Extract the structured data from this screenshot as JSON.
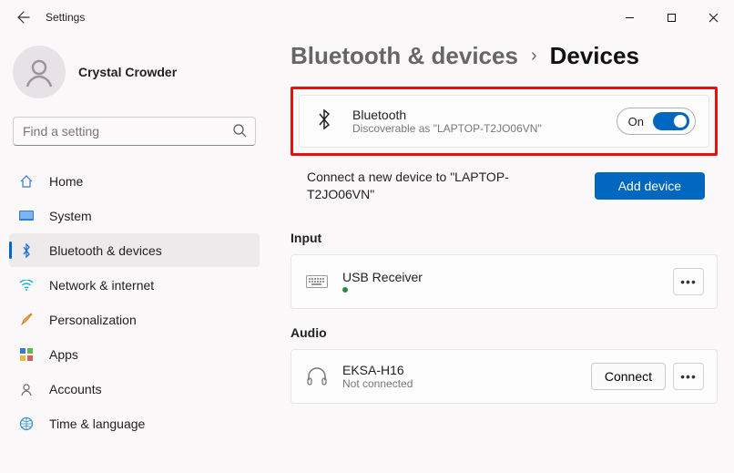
{
  "window": {
    "title": "Settings"
  },
  "user": {
    "name": "Crystal Crowder"
  },
  "search": {
    "placeholder": "Find a setting"
  },
  "nav": {
    "items": [
      {
        "label": "Home"
      },
      {
        "label": "System"
      },
      {
        "label": "Bluetooth & devices"
      },
      {
        "label": "Network & internet"
      },
      {
        "label": "Personalization"
      },
      {
        "label": "Apps"
      },
      {
        "label": "Accounts"
      },
      {
        "label": "Time & language"
      }
    ],
    "active_index": 2
  },
  "breadcrumb": {
    "parent": "Bluetooth & devices",
    "separator": "›",
    "current": "Devices"
  },
  "bluetooth": {
    "title": "Bluetooth",
    "subtitle": "Discoverable as \"LAPTOP-T2JO06VN\"",
    "toggle_label": "On"
  },
  "connect": {
    "text": "Connect a new device to \"LAPTOP-T2JO06VN\"",
    "button": "Add device"
  },
  "sections": {
    "input": {
      "title": "Input",
      "device": {
        "name": "USB Receiver"
      }
    },
    "audio": {
      "title": "Audio",
      "device": {
        "name": "EKSA-H16",
        "status": "Not connected",
        "action": "Connect"
      }
    }
  }
}
